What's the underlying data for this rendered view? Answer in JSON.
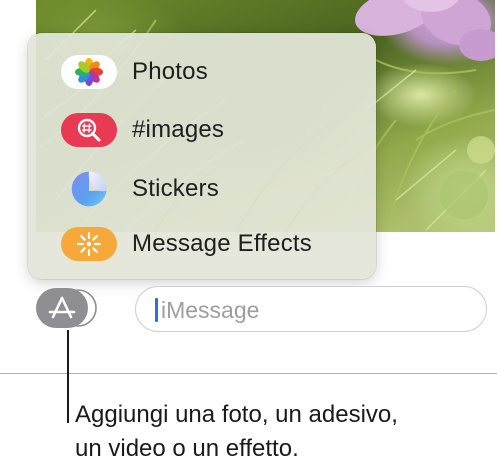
{
  "app_menu": {
    "items": [
      {
        "id": "photos",
        "label": "Photos",
        "icon": "photos-icon"
      },
      {
        "id": "images",
        "label": "#images",
        "icon": "images-search-icon"
      },
      {
        "id": "stickers",
        "label": "Stickers",
        "icon": "stickers-icon"
      },
      {
        "id": "effects",
        "label": "Message Effects",
        "icon": "message-effects-icon"
      }
    ]
  },
  "compose": {
    "apps_button_icon": "app-store-icon",
    "placeholder": "iMessage"
  },
  "callout": {
    "line1": "Aggiungi una foto, un adesivo,",
    "line2": "un video o un effetto."
  },
  "colors": {
    "images_icon_bg": "#e93a54",
    "effects_icon_bg": "#f6a83a",
    "caret": "#2f6fe4",
    "apps_button": "#8e8e93"
  }
}
